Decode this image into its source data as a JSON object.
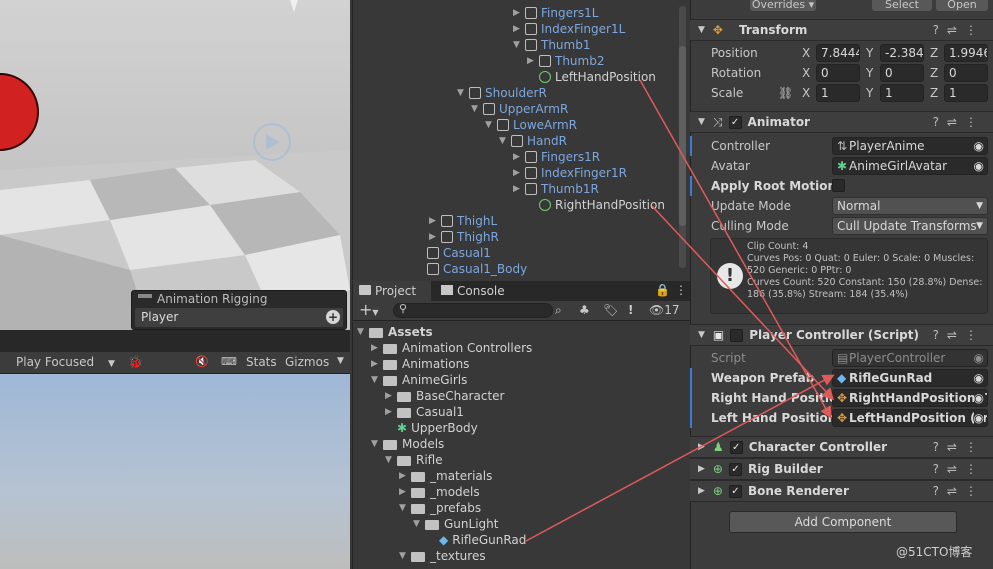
{
  "scene": {
    "overlay_title": "Animation Rigging",
    "overlay_item": "Player"
  },
  "game_toolbar": {
    "play_mode": "Play Focused",
    "stats": "Stats",
    "gizmos": "Gizmos"
  },
  "hierarchy": {
    "rows": [
      {
        "label": "Fingers1L",
        "color": "blue"
      },
      {
        "label": "IndexFinger1L",
        "color": "blue"
      },
      {
        "label": "Thumb1",
        "color": "blue"
      },
      {
        "label": "Thumb2",
        "color": "blue"
      },
      {
        "label": "LeftHandPosition",
        "color": "white"
      },
      {
        "label": "ShoulderR",
        "color": "blue"
      },
      {
        "label": "UpperArmR",
        "color": "blue"
      },
      {
        "label": "LoweArmR",
        "color": "blue"
      },
      {
        "label": "HandR",
        "color": "blue"
      },
      {
        "label": "Fingers1R",
        "color": "blue"
      },
      {
        "label": "IndexFinger1R",
        "color": "blue"
      },
      {
        "label": "Thumb1R",
        "color": "blue"
      },
      {
        "label": "RightHandPosition",
        "color": "white"
      },
      {
        "label": "ThighL",
        "color": "blue"
      },
      {
        "label": "ThighR",
        "color": "blue"
      },
      {
        "label": "Casual1",
        "color": "blue"
      },
      {
        "label": "Casual1_Body",
        "color": "blue"
      }
    ]
  },
  "project": {
    "tab_project": "Project",
    "tab_console": "Console",
    "badge_count": "17",
    "tree": [
      {
        "label": "Assets",
        "bold": true
      },
      {
        "label": "Animation Controllers"
      },
      {
        "label": "Animations"
      },
      {
        "label": "AnimeGirls"
      },
      {
        "label": "BaseCharacter"
      },
      {
        "label": "Casual1"
      },
      {
        "label": "UpperBody"
      },
      {
        "label": "Models"
      },
      {
        "label": "Rifle"
      },
      {
        "label": "_materials"
      },
      {
        "label": "_models"
      },
      {
        "label": "_prefabs"
      },
      {
        "label": "GunLight"
      },
      {
        "label": "RifleGunRad"
      },
      {
        "label": "_textures"
      }
    ]
  },
  "inspector": {
    "top_overrides": "Overrides",
    "top_select": "Select",
    "top_open": "Open",
    "transform": {
      "title": "Transform",
      "position_label": "Position",
      "rotation_label": "Rotation",
      "scale_label": "Scale",
      "position": {
        "x": "7.8444",
        "y": "-2.384",
        "z": "1.9946"
      },
      "rotation": {
        "x": "0",
        "y": "0",
        "z": "0"
      },
      "scale": {
        "x": "1",
        "y": "1",
        "z": "1"
      }
    },
    "animator": {
      "title": "Animator",
      "controller_label": "Controller",
      "controller_value": "PlayerAnime",
      "avatar_label": "Avatar",
      "avatar_value": "AnimeGirlAvatar",
      "apply_root_label": "Apply Root Motion",
      "update_mode_label": "Update Mode",
      "update_mode_value": "Normal",
      "culling_label": "Culling Mode",
      "culling_value": "Cull Update Transforms",
      "info_lines": [
        "Clip Count: 4",
        "Curves Pos: 0 Quat: 0 Euler: 0 Scale: 0 Muscles:",
        "520 Generic: 0 PPtr: 0",
        "Curves Count: 520 Constant: 150 (28.8%) Dense:",
        "186 (35.8%) Stream: 184 (35.4%)"
      ]
    },
    "player_controller": {
      "title": "Player Controller (Script)",
      "script_label": "Script",
      "script_value": "PlayerController",
      "weapon_label": "Weapon Prefab",
      "weapon_value": "RifleGunRad",
      "right_label": "Right Hand Position",
      "right_value": "RightHandPosition (T",
      "left_label": "Left Hand Position",
      "left_value": "LeftHandPosition (Tr"
    },
    "character_controller": "Character Controller",
    "rig_builder": "Rig Builder",
    "bone_renderer": "Bone Renderer",
    "add_component": "Add Component"
  },
  "watermark": "@51CTO博客",
  "colors": {
    "accent": "#3d7ad6",
    "arrow": "#e05a5a",
    "hier_blue": "#7ba7e0"
  }
}
